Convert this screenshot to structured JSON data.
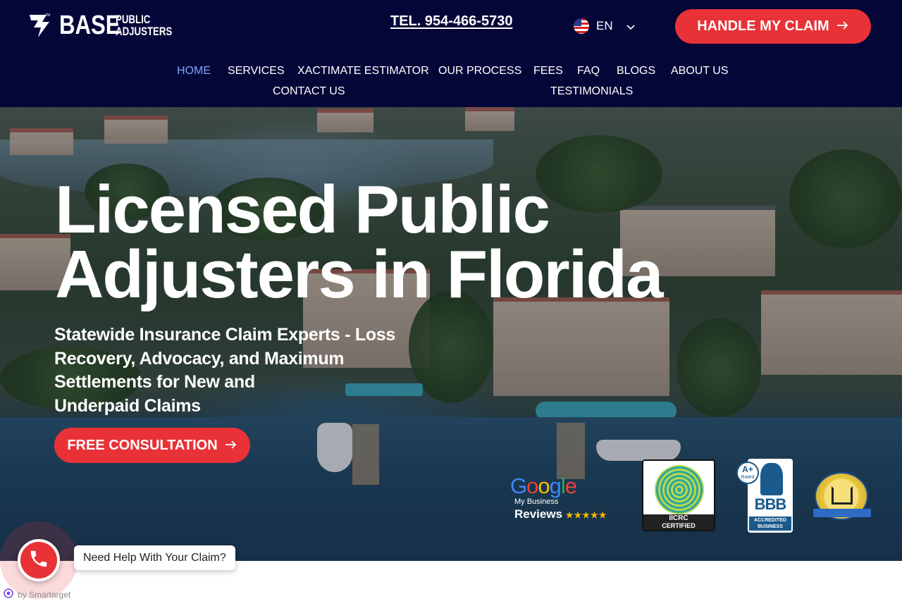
{
  "header": {
    "logo": {
      "word": "BASE",
      "line1": "PUBLIC",
      "line2": "ADJUSTERS",
      "icon": "base-logo-icon"
    },
    "phone": "TEL. 954-466-5730",
    "language": {
      "code": "EN",
      "icon": "us-flag-icon"
    },
    "cta": {
      "label": "HANDLE MY CLAIM",
      "icon": "arrow-right-icon"
    },
    "colors": {
      "background": "#050638",
      "accent": "#e83237",
      "active_nav": "#7fa6ff"
    }
  },
  "nav": {
    "items": [
      {
        "label": "HOME",
        "active": true
      },
      {
        "label": "SERVICES"
      },
      {
        "label": "XACTIMATE ESTIMATOR"
      },
      {
        "label": "OUR PROCESS"
      },
      {
        "label": "FEES"
      },
      {
        "label": "FAQ"
      },
      {
        "label": "BLOGS"
      },
      {
        "label": "ABOUT US"
      },
      {
        "label": "CONTACT US"
      },
      {
        "label": "TESTIMONIALS"
      }
    ]
  },
  "hero": {
    "title_line1": "Licensed Public",
    "title_line2": "Adjusters in Florida",
    "subtitle_lines": [
      "Statewide Insurance Claim Experts - Loss",
      "Recovery, Advocacy, and Maximum",
      "Settlements for New and",
      "Underpaid Claims"
    ],
    "cta": {
      "label": "FREE CONSULTATION",
      "icon": "arrow-right-icon"
    }
  },
  "badges": {
    "google": {
      "letters": [
        "G",
        "o",
        "o",
        "g",
        "l",
        "e"
      ],
      "colors": [
        "#4285f4",
        "#ea4335",
        "#fbbc05",
        "#4285f4",
        "#34a853",
        "#ea4335"
      ],
      "sub": "My Business",
      "reviews": "Reviews",
      "stars": "★★★★★"
    },
    "iicrc": {
      "line1": "IICRC",
      "line2": "CERTIFIED"
    },
    "bbb": {
      "grade": "A+",
      "rated": "Rated",
      "name": "BBB",
      "line1": "ACCREDITED",
      "line2": "BUSINESS"
    },
    "seal": {
      "icon": "house-seal-icon"
    }
  },
  "help_widget": {
    "bubble": "Need Help With Your Claim?",
    "icon": "phone-icon",
    "powered": "by Smartarget"
  }
}
